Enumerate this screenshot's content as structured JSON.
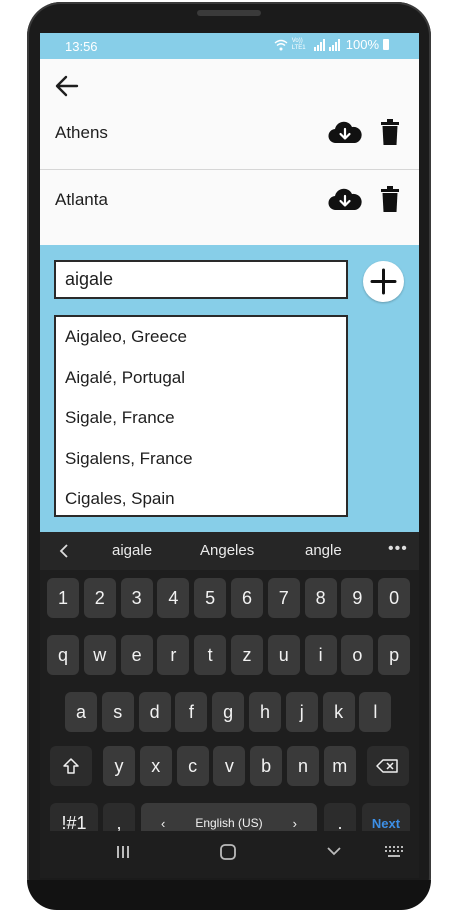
{
  "status_bar": {
    "time": "13:56",
    "network_label": "Vo)) LTE1",
    "battery": "100%"
  },
  "cities": [
    {
      "name": "Athens"
    },
    {
      "name": "Atlanta"
    }
  ],
  "search": {
    "value": "aigale"
  },
  "suggestions": [
    "Aigaleo, Greece",
    "Aigalé, Portugal",
    "Sigale, France",
    "Sigalens, France",
    "Cigales, Spain"
  ],
  "keyboard": {
    "word_suggestions": [
      "aigale",
      "Angeles",
      "angle"
    ],
    "more_label": "•••",
    "row_numbers": [
      "1",
      "2",
      "3",
      "4",
      "5",
      "6",
      "7",
      "8",
      "9",
      "0"
    ],
    "row_q": [
      "q",
      "w",
      "e",
      "r",
      "t",
      "z",
      "u",
      "i",
      "o",
      "p"
    ],
    "row_a": [
      "a",
      "s",
      "d",
      "f",
      "g",
      "h",
      "j",
      "k",
      "l"
    ],
    "row_y": [
      "y",
      "x",
      "c",
      "v",
      "b",
      "n",
      "m"
    ],
    "symbols_label": "!#1",
    "comma_label": ",",
    "space_label": "English (US)",
    "period_label": ".",
    "next_label": "Next"
  },
  "colors": {
    "accent": "#87cee8",
    "keyboard_bg": "#1e1e1e",
    "key_bg": "#3a3a3a",
    "next_blue": "#3d8fe6"
  },
  "icons": {
    "back": "arrow-left-icon",
    "cloud": "cloud-download-icon",
    "trash": "trash-icon",
    "add": "plus-icon"
  }
}
